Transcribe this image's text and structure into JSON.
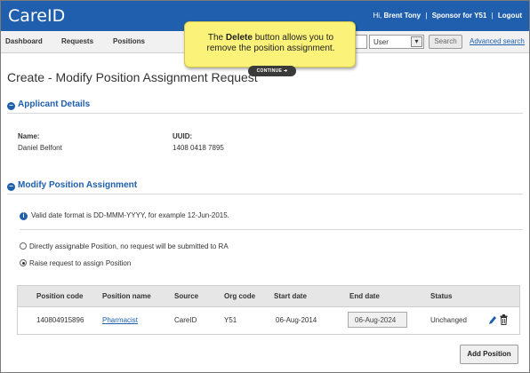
{
  "app": {
    "title": "CareID",
    "greeting": "Hi,",
    "user_name": "Brent Tony",
    "role": "Sponsor for Y51",
    "logout": "Logout"
  },
  "nav": {
    "items": [
      "Dashboard",
      "Requests",
      "Positions"
    ],
    "search_scope": "User",
    "search_button": "Search",
    "advanced_search": "Advanced search"
  },
  "page": {
    "title": "Create - Modify Position Assignment Request"
  },
  "applicant": {
    "header": "Applicant Details",
    "name_label": "Name:",
    "name_value": "Daniel Belfont",
    "uuid_label": "UUID:",
    "uuid_value": "1408 0418 7895"
  },
  "modify": {
    "header": "Modify Position Assignment",
    "info": "Valid date format is DD-MMM-YYYY, for example 12-Jun-2015.",
    "option_direct": "Directly assignable Position, no request will be submitted to RA",
    "option_raise": "Raise request to assign Position"
  },
  "table": {
    "columns": [
      "Position code",
      "Position name",
      "Source",
      "Org code",
      "Start date",
      "End date",
      "Status"
    ],
    "rows": [
      {
        "position_code": "140804915896",
        "position_name": "Pharmacist",
        "source": "CareID",
        "org_code": "Y51",
        "start_date": "06-Aug-2014",
        "end_date": "06-Aug-2024",
        "status": "Unchanged"
      }
    ]
  },
  "actions": {
    "add_position": "Add Position"
  },
  "tooltip": {
    "prefix": "The ",
    "bold": "Delete",
    "suffix": " button allows you to remove the position assignment.",
    "continue": "CONTINUE ➜"
  },
  "colors": {
    "brand": "#1f5fae",
    "tooltip_bg": "#fbf279"
  },
  "icons": [
    "edit-icon",
    "delete-icon",
    "info-icon",
    "collapse-icon",
    "chevron-down-icon"
  ]
}
